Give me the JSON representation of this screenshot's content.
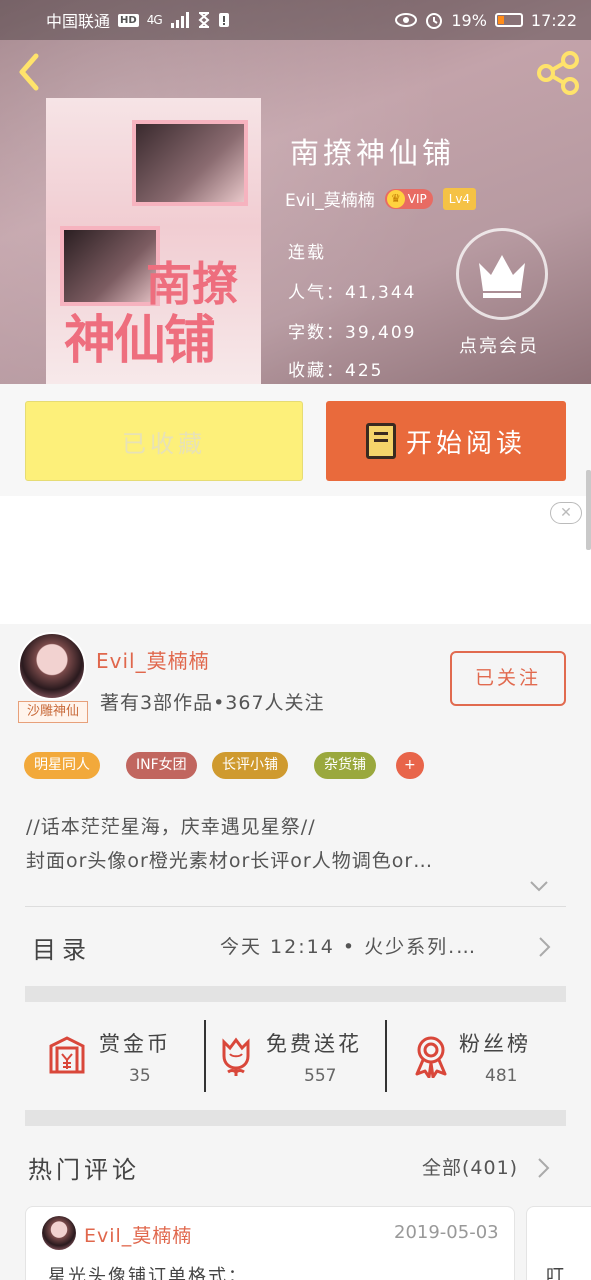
{
  "status_bar": {
    "carrier": "中国联通",
    "hd": "HD",
    "network": "4G",
    "battery_pct": "19%",
    "time": "17:22"
  },
  "book": {
    "title": "南撩神仙铺",
    "author": "Evil_莫楠楠",
    "vip": "VIP",
    "level": "Lv4",
    "status": "连载",
    "popularity": "人气：41,344",
    "word_count": "字数：39,409",
    "favorites": "收藏：425",
    "cover_title_1": "南撩",
    "cover_title_2": "神仙铺"
  },
  "vip_cta": {
    "label": "点亮会员"
  },
  "actions": {
    "favorited": "已收藏",
    "start_reading": "开始阅读"
  },
  "ad": {
    "close": "✕"
  },
  "author_section": {
    "name": "Evil_莫楠楠",
    "stats": "著有3部作品•367人关注",
    "avatar_tag": "沙雕神仙",
    "follow": "已关注",
    "tags": [
      {
        "label": "明星同人",
        "color": "#f2a93b"
      },
      {
        "label": "INF女团",
        "color": "#c1665f"
      },
      {
        "label": "长评小铺",
        "color": "#cf9a2f"
      },
      {
        "label": "杂货铺",
        "color": "#9aa83d"
      },
      {
        "label": "+",
        "color": "#e8654a"
      }
    ],
    "intro_line1": "//话本茫茫星海，庆幸遇见星祭//",
    "intro_line2": "封面or头像or橙光素材or长评or人物调色or…"
  },
  "toc": {
    "label": "目录",
    "latest": "今天 12:14 • 火少系列.…"
  },
  "stats": [
    {
      "label": "赏金币",
      "value": "35",
      "color": "#d9473a"
    },
    {
      "label": "免费送花",
      "value": "557",
      "color": "#d9473a"
    },
    {
      "label": "粉丝榜",
      "value": "481",
      "color": "#d9473a"
    }
  ],
  "comments_header": {
    "title": "热门评论",
    "all": "全部(401)"
  },
  "comments": [
    {
      "name": "Evil_莫楠楠",
      "date": "2019-05-03",
      "text": "星光头像铺订单格式："
    },
    {
      "text": "叮"
    }
  ]
}
